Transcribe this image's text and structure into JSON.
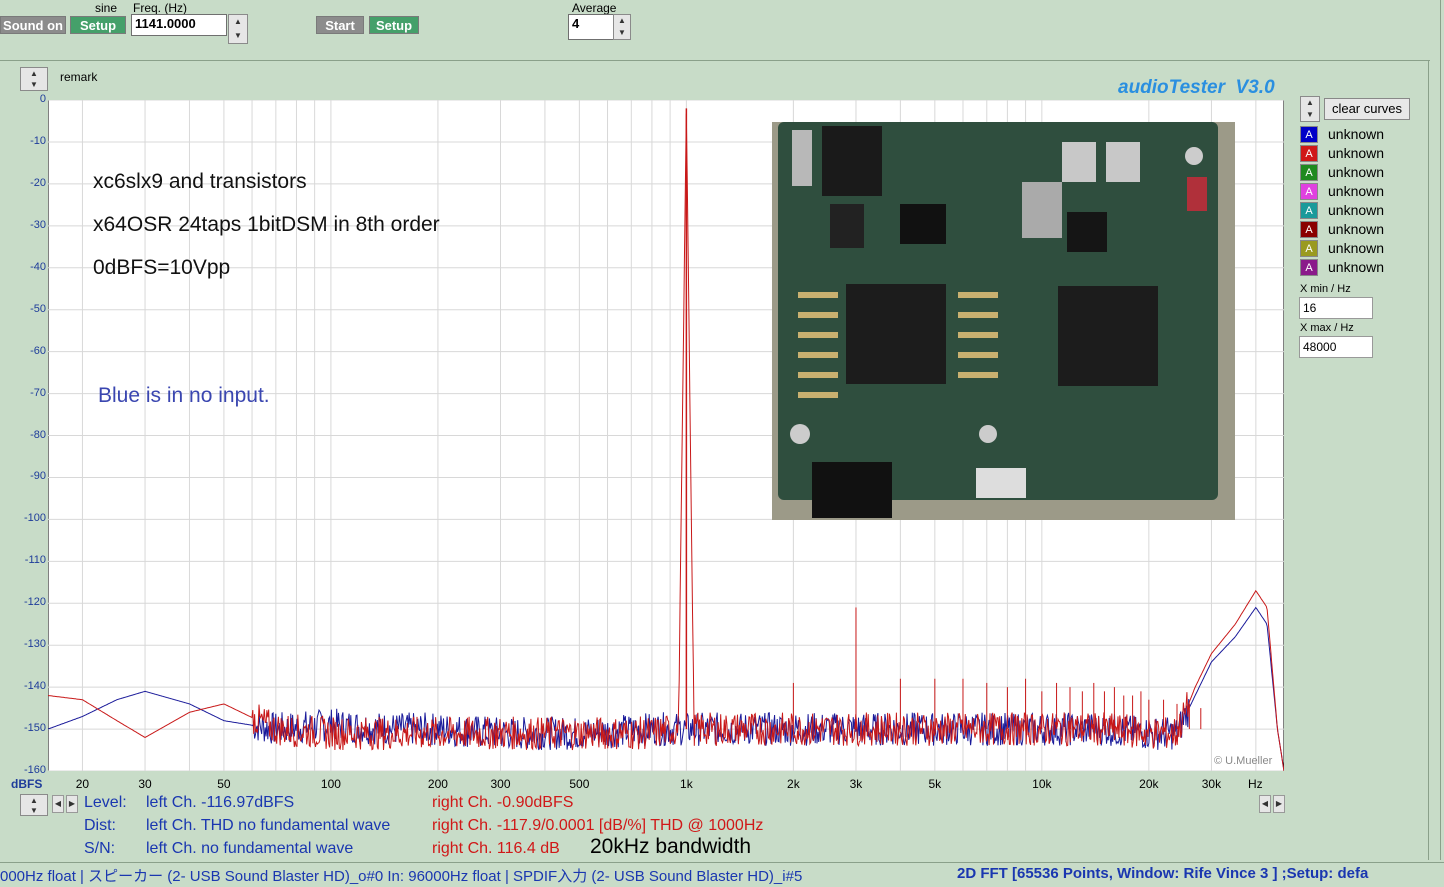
{
  "toolbar": {
    "sound_on_label": "Sound on",
    "waveform_label": "sine",
    "setup1_label": "Setup",
    "freq_label": "Freq. (Hz)",
    "freq_value": "1141.0000",
    "start_label": "Start",
    "setup2_label": "Setup",
    "average_label": "Average",
    "average_value": "4"
  },
  "remark_label": "remark",
  "app_title": "audioTester  V3.0",
  "legend": {
    "clear_label": "clear curves",
    "items": [
      {
        "letter": "A",
        "label": "unknown",
        "color": "#0000c8"
      },
      {
        "letter": "A",
        "label": "unknown",
        "color": "#d01818"
      },
      {
        "letter": "A",
        "label": "unknown",
        "color": "#1f8a1f"
      },
      {
        "letter": "A",
        "label": "unknown",
        "color": "#e040e0"
      },
      {
        "letter": "A",
        "label": "unknown",
        "color": "#1a9a9a"
      },
      {
        "letter": "A",
        "label": "unknown",
        "color": "#8a0000"
      },
      {
        "letter": "A",
        "label": "unknown",
        "color": "#9a9a20"
      },
      {
        "letter": "A",
        "label": "unknown",
        "color": "#8a1a8a"
      }
    ],
    "xmin_label": "X min / Hz",
    "xmin_value": "16",
    "xmax_label": "X max / Hz",
    "xmax_value": "48000"
  },
  "notes": {
    "line1": "xc6slx9 and transistors",
    "line2": "x64OSR 24taps 1bitDSM in 8th order",
    "line3": "0dBFS=10Vpp",
    "line4": "Blue is in no input."
  },
  "photo_alt": "circuit board photo",
  "copyright": "© U.Mueller",
  "axis": {
    "y_unit": "dBFS",
    "x_unit": "Hz"
  },
  "measurements": {
    "level_label": "Level:",
    "level_left": "left Ch. -116.97dBFS",
    "level_right": "right Ch. -0.90dBFS",
    "dist_label": "Dist:",
    "dist_left": "left Ch. THD no fundamental wave",
    "dist_right": "right Ch. -117.9/0.0001 [dB/%] THD @ 1000Hz",
    "sn_label": "S/N:",
    "sn_left": "left Ch.  no fundamental wave",
    "sn_right": "right Ch. 116.4 dB",
    "bandwidth": "20kHz bandwidth"
  },
  "status": {
    "left": "000Hz float  | スピーカー (2- USB Sound Blaster HD)_o#0  In: 96000Hz float  | SPDIF入力 (2- USB Sound Blaster HD)_i#5",
    "right": "2D FFT [65536 Points, Window: Rife Vince 3 ]  ;Setup:  defa"
  },
  "chart_data": {
    "type": "line",
    "title": "",
    "xlabel": "Hz",
    "ylabel": "dBFS",
    "xscale": "log",
    "xlim": [
      16,
      48000
    ],
    "ylim": [
      -160,
      0
    ],
    "x_ticks": [
      20,
      30,
      50,
      100,
      200,
      300,
      500,
      1000,
      2000,
      3000,
      5000,
      10000,
      20000,
      30000
    ],
    "x_tick_labels": [
      "20",
      "30",
      "50",
      "100",
      "200",
      "300",
      "500",
      "1k",
      "2k",
      "3k",
      "5k",
      "10k",
      "20k",
      "30k"
    ],
    "y_ticks": [
      0,
      -10,
      -20,
      -30,
      -40,
      -50,
      -60,
      -70,
      -80,
      -90,
      -100,
      -110,
      -120,
      -130,
      -140,
      -150,
      -160
    ],
    "grid": true,
    "series": [
      {
        "color": "#1a1a9a",
        "points": [
          [
            16,
            -150
          ],
          [
            20,
            -147
          ],
          [
            25,
            -143
          ],
          [
            30,
            -141
          ],
          [
            40,
            -144
          ],
          [
            50,
            -148
          ],
          [
            70,
            -150
          ],
          [
            100,
            -149
          ],
          [
            150,
            -150
          ],
          [
            200,
            -150
          ],
          [
            300,
            -151
          ],
          [
            500,
            -151
          ],
          [
            800,
            -150
          ],
          [
            1000,
            -150
          ],
          [
            1500,
            -150
          ],
          [
            2000,
            -150
          ],
          [
            3000,
            -150
          ],
          [
            5000,
            -150
          ],
          [
            10000,
            -150
          ],
          [
            15000,
            -150
          ],
          [
            20000,
            -151
          ],
          [
            24000,
            -151
          ],
          [
            27000,
            -142
          ],
          [
            30000,
            -134
          ],
          [
            35000,
            -128
          ],
          [
            40000,
            -121
          ],
          [
            43000,
            -125
          ],
          [
            46000,
            -150
          ],
          [
            48000,
            -160
          ]
        ]
      },
      {
        "color": "#c81818",
        "points": [
          [
            16,
            -142
          ],
          [
            20,
            -143
          ],
          [
            25,
            -148
          ],
          [
            30,
            -152
          ],
          [
            40,
            -146
          ],
          [
            50,
            -144
          ],
          [
            70,
            -150
          ],
          [
            100,
            -151
          ],
          [
            150,
            -151
          ],
          [
            200,
            -151
          ],
          [
            300,
            -151
          ],
          [
            500,
            -151
          ],
          [
            800,
            -151
          ],
          [
            950,
            -150
          ],
          [
            1000,
            -2
          ],
          [
            1050,
            -150
          ],
          [
            1500,
            -150
          ],
          [
            2000,
            -150
          ],
          [
            3000,
            -150
          ],
          [
            5000,
            -150
          ],
          [
            10000,
            -150
          ],
          [
            15000,
            -150
          ],
          [
            20000,
            -151
          ],
          [
            24000,
            -151
          ],
          [
            27000,
            -140
          ],
          [
            30000,
            -132
          ],
          [
            35000,
            -125
          ],
          [
            40000,
            -117
          ],
          [
            43000,
            -121
          ],
          [
            46000,
            -150
          ],
          [
            48000,
            -160
          ]
        ],
        "spikes": [
          [
            2000,
            -139
          ],
          [
            3000,
            -121
          ],
          [
            4000,
            -138
          ],
          [
            5000,
            -138
          ],
          [
            6000,
            -138
          ],
          [
            7000,
            -139
          ],
          [
            8000,
            -140
          ],
          [
            9000,
            -138
          ],
          [
            10000,
            -141
          ],
          [
            11000,
            -139
          ],
          [
            12000,
            -140
          ],
          [
            13000,
            -141
          ],
          [
            14000,
            -139
          ],
          [
            15000,
            -141
          ],
          [
            16000,
            -140
          ],
          [
            17000,
            -142
          ],
          [
            18000,
            -142
          ],
          [
            19000,
            -141
          ],
          [
            20000,
            -143
          ],
          [
            22000,
            -143
          ],
          [
            24000,
            -144
          ],
          [
            26000,
            -144
          ],
          [
            28000,
            -145
          ]
        ]
      }
    ]
  }
}
